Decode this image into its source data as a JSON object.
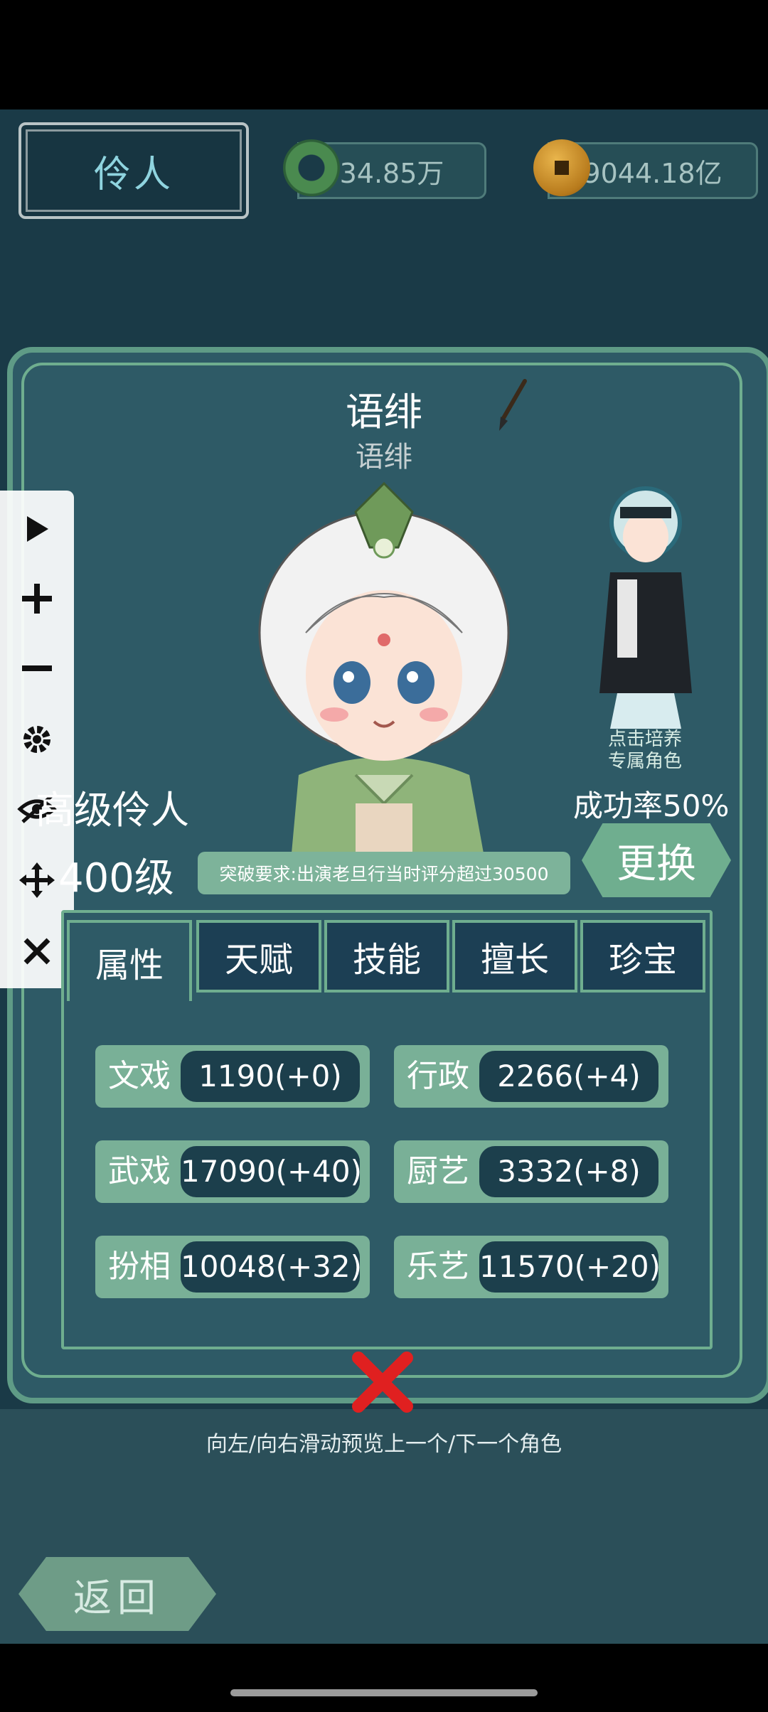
{
  "header": {
    "title": "伶人",
    "jade_amount": "34.85万",
    "coin_amount": "9044.18亿"
  },
  "character": {
    "name": "语绯",
    "subname": "语绯",
    "rank": "高级伶人",
    "level": "400级",
    "breakthrough_requirement": "突破要求:出演老旦行当时评分超过30500",
    "cultivate_hint": "点击培养\n专属角色",
    "success_rate": "成功率50%",
    "change_label": "更换"
  },
  "tabs": [
    {
      "label": "属性",
      "active": true
    },
    {
      "label": "天赋",
      "active": false
    },
    {
      "label": "技能",
      "active": false
    },
    {
      "label": "擅长",
      "active": false
    },
    {
      "label": "珍宝",
      "active": false
    }
  ],
  "stats": [
    {
      "label": "文戏",
      "value": "1190(+0)"
    },
    {
      "label": "行政",
      "value": "2266(+4)"
    },
    {
      "label": "武戏",
      "value": "17090(+40)"
    },
    {
      "label": "厨艺",
      "value": "3332(+8)"
    },
    {
      "label": "扮相",
      "value": "10048(+32)"
    },
    {
      "label": "乐艺",
      "value": "11570(+20)"
    }
  ],
  "hint": "向左/向右滑动预览上一个/下一个角色",
  "back_label": "返回",
  "toolbar": [
    "play-icon",
    "plus-icon",
    "minus-icon",
    "gear-icon",
    "eye-off-icon",
    "move-icon",
    "close-icon"
  ]
}
